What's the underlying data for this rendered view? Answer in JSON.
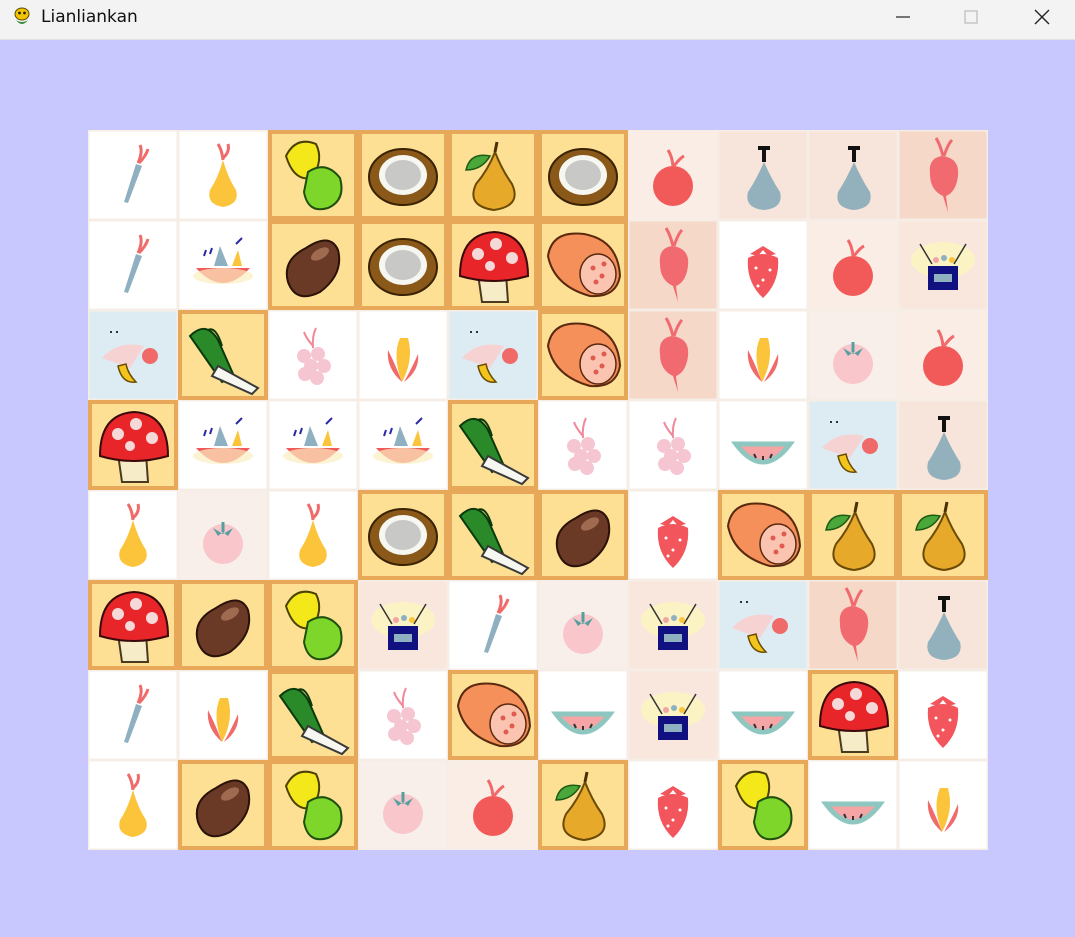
{
  "window": {
    "title": "Lianliankan",
    "app_icon": "snake-icon",
    "controls": [
      "minimize-icon",
      "maximize-icon",
      "close-icon"
    ]
  },
  "colors": {
    "background": "#c8c8ff",
    "titlebar": "#f3f3f3",
    "orange_tile": "#fde094",
    "orange_border": "#e7a85a"
  },
  "board": {
    "rows": 8,
    "cols": 10,
    "tiles": [
      [
        "carrot",
        "pear-yellow",
        "corn-pepper",
        "coconut",
        "pear-orange",
        "coconut",
        "red-fruit",
        "pear-gray",
        "pear-gray",
        "radish"
      ],
      [
        "carrot",
        "fruit-basket",
        "potato",
        "coconut",
        "mushroom",
        "ham",
        "radish",
        "strawberry",
        "red-fruit",
        "gift-box"
      ],
      [
        "banana-plate",
        "leek",
        "grapes",
        "corn-red",
        "banana-plate",
        "ham",
        "radish",
        "corn-red",
        "tomato",
        "red-fruit"
      ],
      [
        "mushroom",
        "fruit-basket",
        "fruit-basket",
        "fruit-basket",
        "leek",
        "grapes",
        "grapes",
        "watermelon",
        "banana-plate",
        "pear-gray"
      ],
      [
        "pear-yellow",
        "tomato",
        "pear-yellow",
        "coconut",
        "leek",
        "potato",
        "strawberry",
        "ham",
        "pear-orange",
        "pear-orange"
      ],
      [
        "mushroom",
        "potato",
        "corn-pepper",
        "gift-box",
        "carrot",
        "tomato",
        "gift-box",
        "banana-plate",
        "radish",
        "pear-gray"
      ],
      [
        "carrot",
        "corn-red",
        "leek",
        "grapes",
        "ham",
        "watermelon",
        "gift-box",
        "watermelon",
        "mushroom",
        "strawberry"
      ],
      [
        "pear-yellow",
        "potato",
        "corn-pepper",
        "tomato",
        "red-fruit",
        "pear-orange",
        "strawberry",
        "corn-pepper",
        "watermelon",
        "corn-red"
      ]
    ]
  }
}
